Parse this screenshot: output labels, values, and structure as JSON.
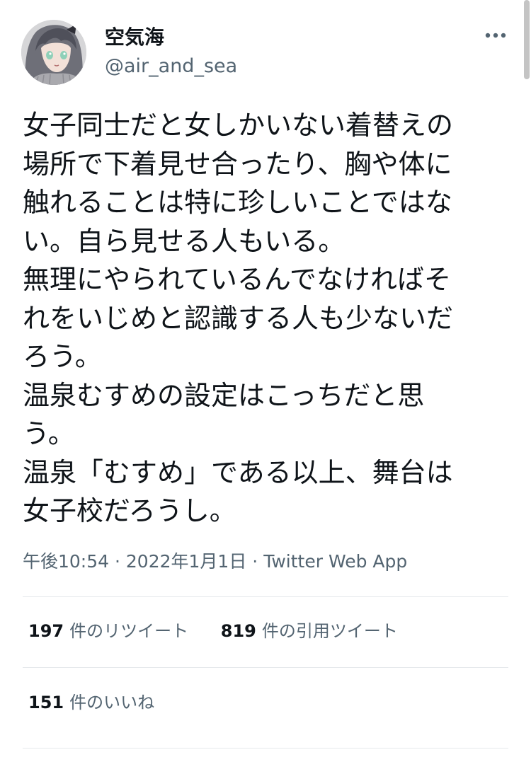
{
  "author": {
    "display_name": "空気海",
    "handle": "@air_and_sea"
  },
  "tweet": {
    "lines": [
      "女子同士だと女しかいない着替えの",
      "場所で下着見せ合ったり、胸や体に",
      "触れることは特に珍しいことではな",
      "い。自ら見せる人もいる。",
      "無理にやられているんでなければそ",
      "れをいじめと認識する人も少ないだ",
      "ろう。",
      "温泉むすめの設定はこっちだと思",
      "う。",
      "温泉「むすめ」である以上、舞台は",
      "女子校だろうし。"
    ]
  },
  "meta": {
    "time": "午後10:54",
    "separator": "·",
    "date": "2022年1月1日",
    "source": "Twitter Web App"
  },
  "stats": {
    "retweets": {
      "count": "197",
      "label": "件のリツイート"
    },
    "quotes": {
      "count": "819",
      "label": "件の引用ツイート"
    },
    "likes": {
      "count": "151",
      "label": "件のいいね"
    }
  },
  "icons": {
    "more": "more-horizontal-icon",
    "avatar": "anime-girl-avatar"
  },
  "colors": {
    "text_primary": "#0f1419",
    "text_secondary": "#536471",
    "divider": "#e6e9ec"
  }
}
